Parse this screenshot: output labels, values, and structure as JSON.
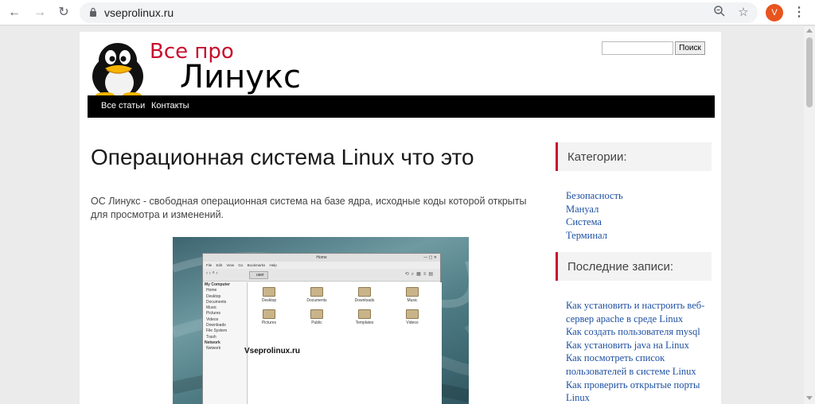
{
  "browser": {
    "url": "vseprolinux.ru",
    "avatar_letter": "V"
  },
  "site": {
    "logo_line1": "Все про",
    "logo_line2": "Линукс",
    "search_button": "Поиск",
    "search_value": "",
    "nav": [
      "Все статьи",
      "Контакты"
    ]
  },
  "post": {
    "title": "Операционная система Linux что это",
    "intro": "ОС Линукс - свободная операционная система на базе ядра, исходные коды которой открыты для просмотра и изменений."
  },
  "screenshot": {
    "window_title": "Home",
    "menu": "File Edit View Go Bookmarks Help",
    "path": "user",
    "sidebar": [
      "My Computer",
      "Home",
      "Desktop",
      "Documents",
      "Music",
      "Pictures",
      "Videos",
      "Downloads",
      "File System",
      "Trash",
      "Network",
      "Network"
    ],
    "folders": [
      "Desktop",
      "Documents",
      "Downloads",
      "Music",
      "Pictures",
      "Public",
      "Templates",
      "Videos"
    ],
    "watermark": "Vseprolinux.ru"
  },
  "sidebar": {
    "categories_title": "Категории:",
    "categories": [
      "Безопасность",
      "Мануал",
      "Система",
      "Терминал"
    ],
    "recent_title": "Последние записи:",
    "recent": [
      "Как установить и настроить веб-сервер apache в среде Linux",
      "Как создать пользователя mysql",
      "Как установить java на Linux",
      "Как посмотреть список пользователей в системе Linux",
      "Как проверить открытые порты Linux"
    ]
  },
  "colors": {
    "accent_red": "#c8102e",
    "link_blue": "#1e50a2",
    "nav_bg": "#000000"
  }
}
